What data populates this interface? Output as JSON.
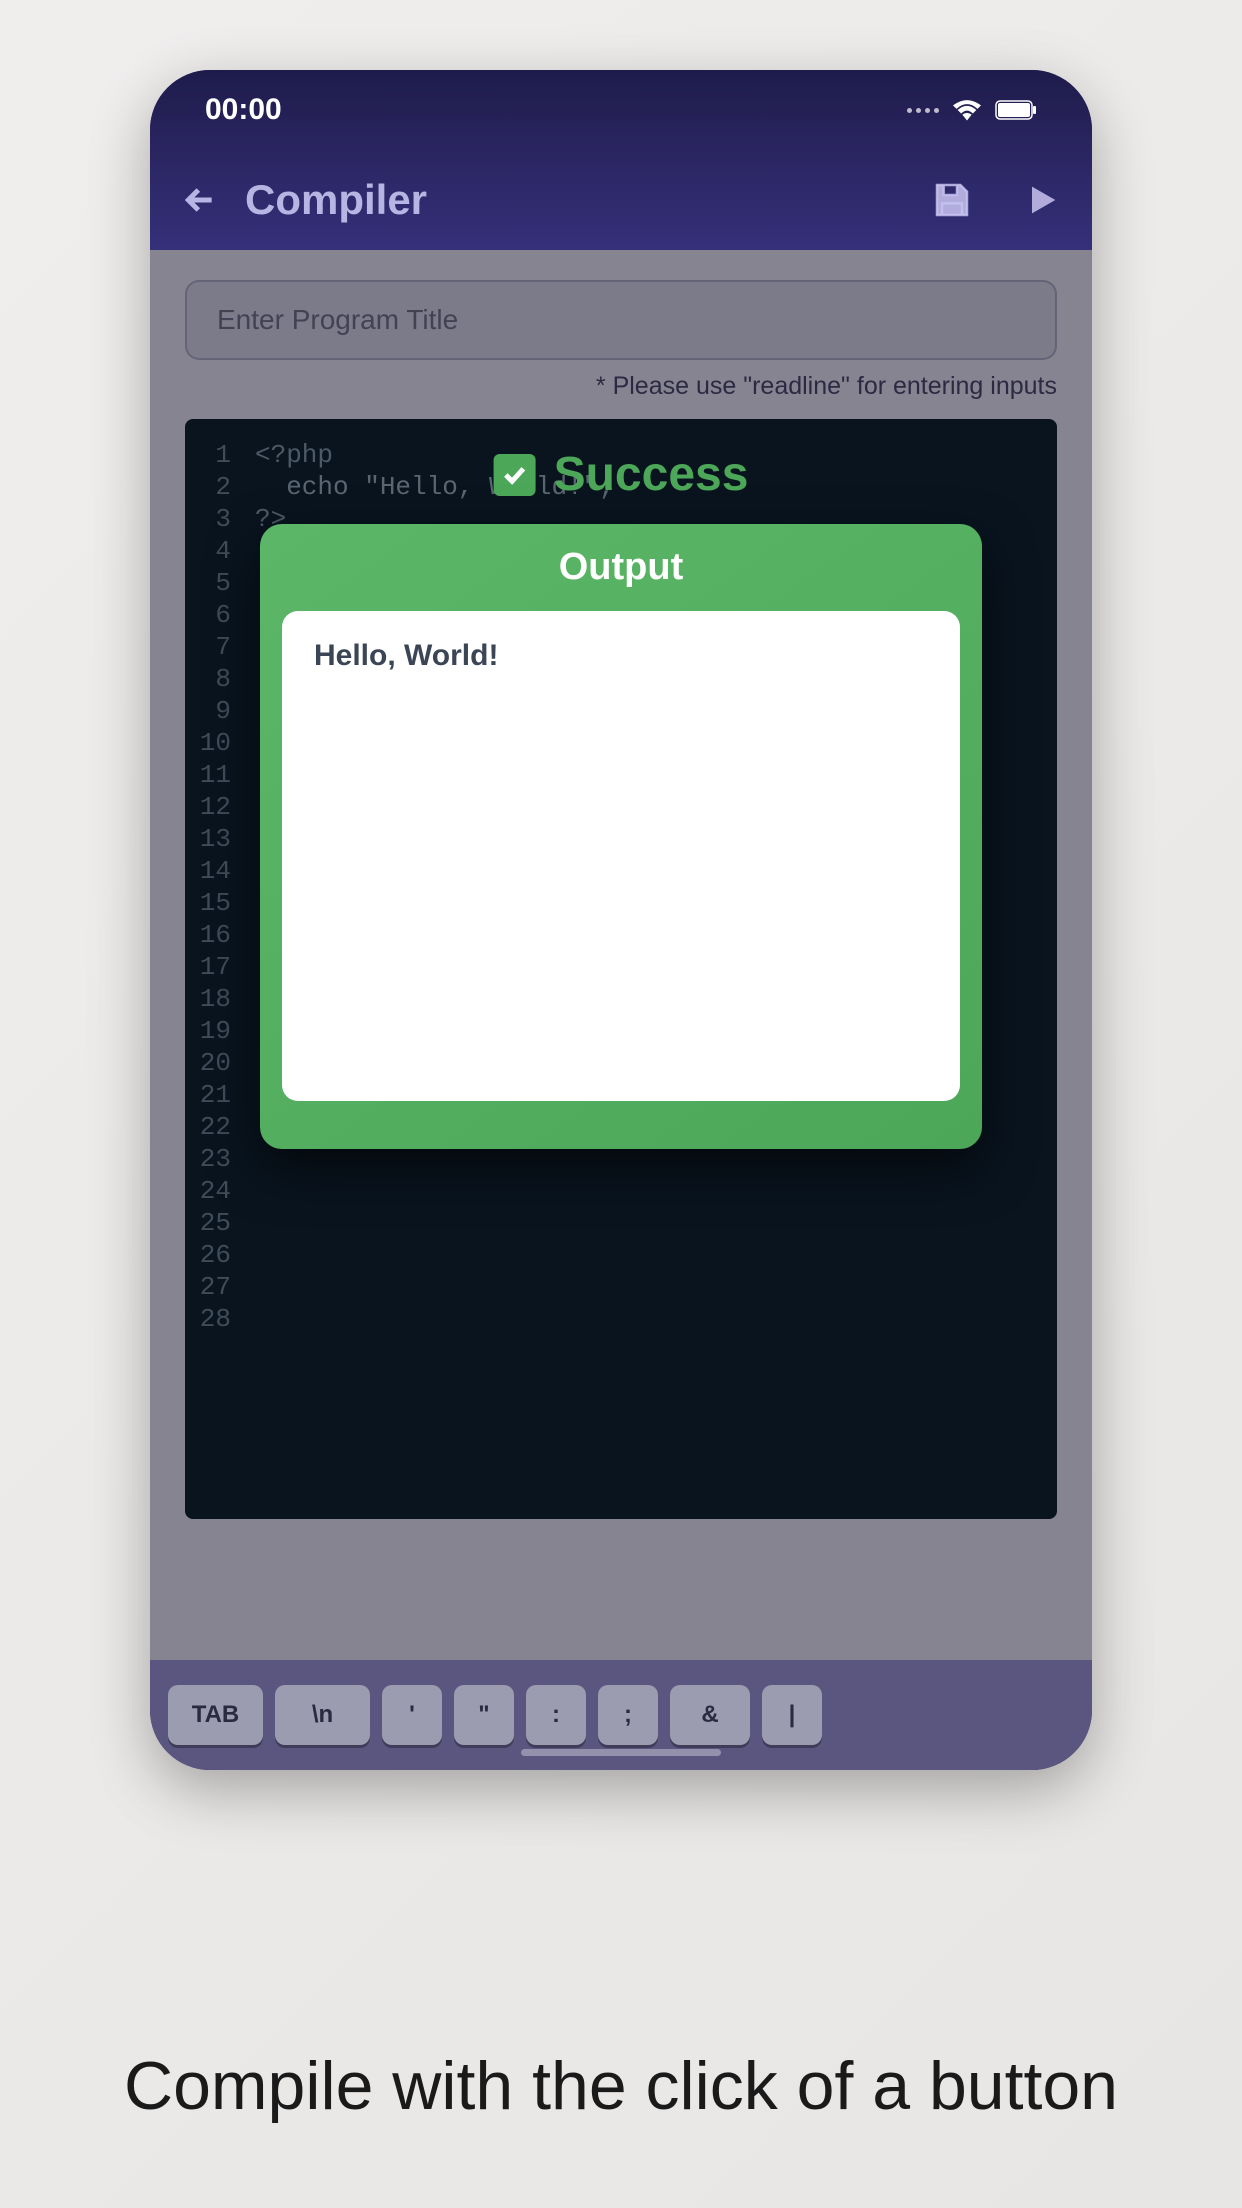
{
  "statusBar": {
    "time": "00:00"
  },
  "header": {
    "title": "Compiler"
  },
  "titleInput": {
    "placeholder": "Enter Program Title"
  },
  "hint": "* Please use \"readline\" for entering inputs",
  "code": {
    "lines": [
      "<?php",
      "  echo \"Hello, World!\";",
      "?>"
    ],
    "totalLines": 28
  },
  "successBadge": {
    "label": "Success"
  },
  "output": {
    "title": "Output",
    "content": "Hello, World!"
  },
  "keyboard": {
    "keys": [
      "TAB",
      "\\n",
      "'",
      "\"",
      ":",
      ";",
      "&",
      "|"
    ]
  },
  "caption": "Compile with the click of a button"
}
